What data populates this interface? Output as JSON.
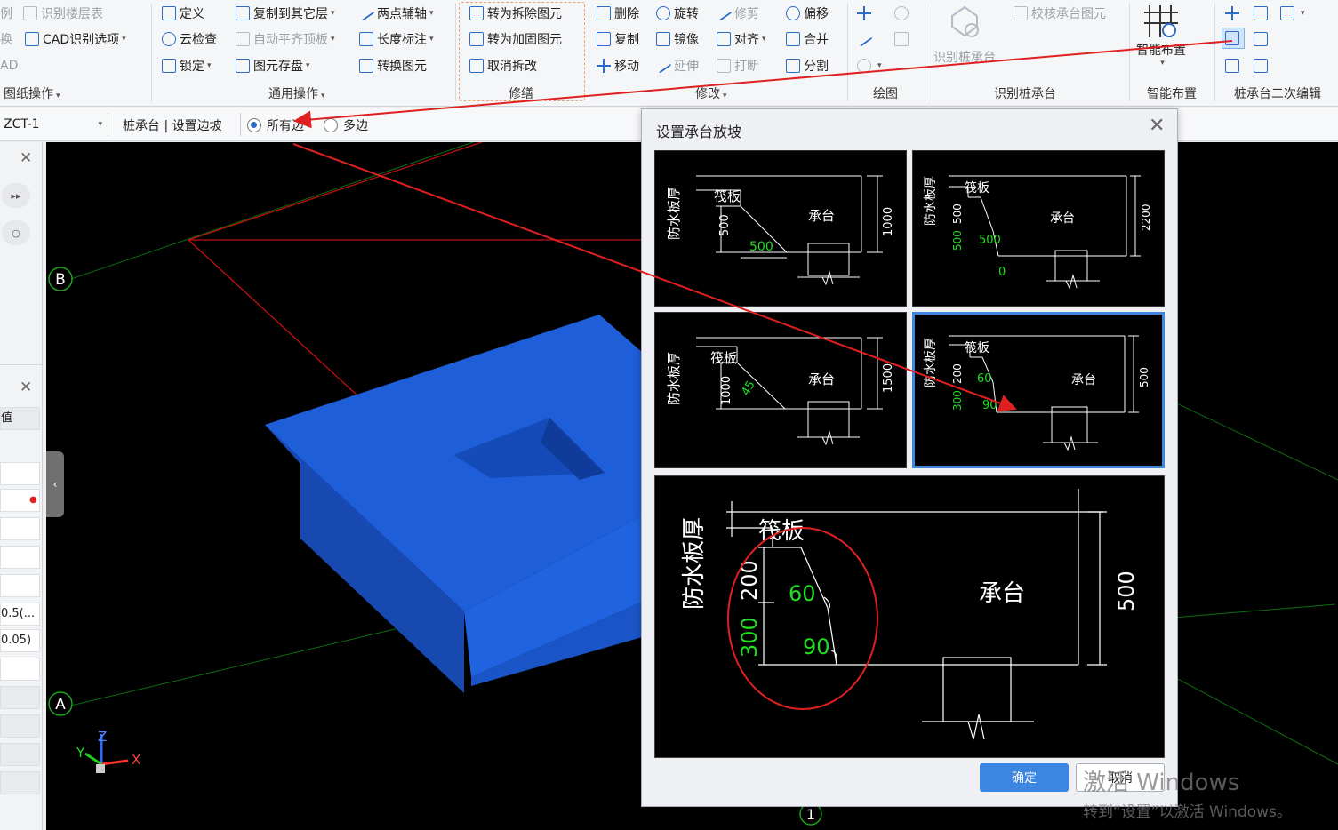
{
  "ribbon": {
    "col1": {
      "r1": "识别楼层表",
      "r2": "CAD识别选项",
      "edge1": "例",
      "edge2": "换",
      "edge3": "AD",
      "group": "图纸操作"
    },
    "col2": {
      "r1": "定义",
      "r2": "云检查",
      "r3": "锁定"
    },
    "col3": {
      "r1": "复制到其它层",
      "r2": "自动平齐顶板",
      "r3": "图元存盘"
    },
    "col4": {
      "r1": "两点辅轴",
      "r2": "长度标注",
      "r3": "转换图元",
      "group": "通用操作"
    },
    "col5": {
      "r1": "转为拆除图元",
      "r2": "转为加固图元",
      "r3": "取消拆改",
      "group": "修缮"
    },
    "col6": {
      "r1": "删除",
      "r2": "复制",
      "r3": "移动"
    },
    "col7": {
      "r1": "旋转",
      "r2": "镜像",
      "r3": "延伸"
    },
    "col8": {
      "r1": "修剪",
      "r2": "对齐",
      "r3": "打断",
      "group": "修改"
    },
    "col9": {
      "r1": "偏移",
      "r2": "合并",
      "r3": "分割"
    },
    "draw_group": "绘图",
    "identify": {
      "big_label": "识别桩承台",
      "check": "校核承台图元",
      "group": "识别桩承台"
    },
    "smart": {
      "big_label": "智能布置",
      "group": "智能布置"
    },
    "edit2_group": "桩承台二次编辑"
  },
  "toolbar2": {
    "layer_value": "ZCT-1",
    "breadcrumb": "桩承台 | 设置边坡",
    "radio_all": "所有边",
    "radio_multi": "多边"
  },
  "left_panel": {
    "value1": "0.5(...",
    "value2": "0.05)",
    "edge_label": "值"
  },
  "viewport": {
    "axis_b": "B",
    "axis_a": "A",
    "axis_1": "1",
    "axis_x": "X",
    "axis_y": "Y",
    "axis_z": "Z"
  },
  "dialog": {
    "title": "设置承台放坡",
    "ok": "确定",
    "cancel": "取消",
    "labels": {
      "waterproof": "防水板厚",
      "raft": "筏板",
      "cap": "承台"
    },
    "option1": {
      "d_left": "500",
      "d_green": "500",
      "d_right": "1000"
    },
    "option2": {
      "d_left": "500",
      "d_green_side": "500",
      "d_green_mid": "500",
      "d_green_zero": "0",
      "d_right": "2200"
    },
    "option3": {
      "d_left": "1000",
      "d_angle": "45",
      "d_right": "1500"
    },
    "option4": {
      "d_left": "200",
      "d_green_side": "300",
      "d_angle1": "60",
      "d_angle2": "90",
      "d_right": "500"
    },
    "preview": {
      "d_top": "200",
      "d_bottom": "300",
      "d_angle1": "60",
      "d_angle2": "90",
      "d_right": "500"
    }
  },
  "watermark": {
    "line1": "激活 Windows",
    "line2": "转到“设置”以激活 Windows。"
  },
  "colors": {
    "cap_blue": "#1a5fd6",
    "highlight_red": "#e02020",
    "dim_green": "#22dd22",
    "select_blue": "#3e86e0"
  }
}
